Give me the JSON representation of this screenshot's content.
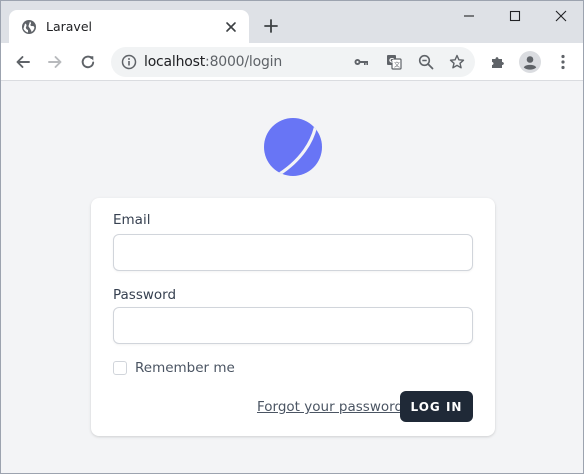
{
  "browser": {
    "tab": {
      "title": "Laravel",
      "favicon": "globe-icon"
    },
    "address_bar": {
      "host": "localhost",
      "rest": ":8000/login",
      "info_icon": "info-icon"
    },
    "toolbar_icons": [
      "back-icon",
      "forward-icon",
      "reload-icon",
      "key-icon",
      "translate-icon",
      "zoom-out-icon",
      "star-icon",
      "extensions-icon",
      "profile-icon",
      "menu-icon"
    ]
  },
  "login": {
    "logo": "laravel-logo",
    "accent_color": "#6875f5",
    "email": {
      "label": "Email",
      "value": "",
      "placeholder": ""
    },
    "password": {
      "label": "Password",
      "value": "",
      "placeholder": ""
    },
    "remember_label": "Remember me",
    "remember_checked": false,
    "forgot_link": "Forgot your password?",
    "submit_label": "LOG IN",
    "submit_color": "#1f2937"
  }
}
